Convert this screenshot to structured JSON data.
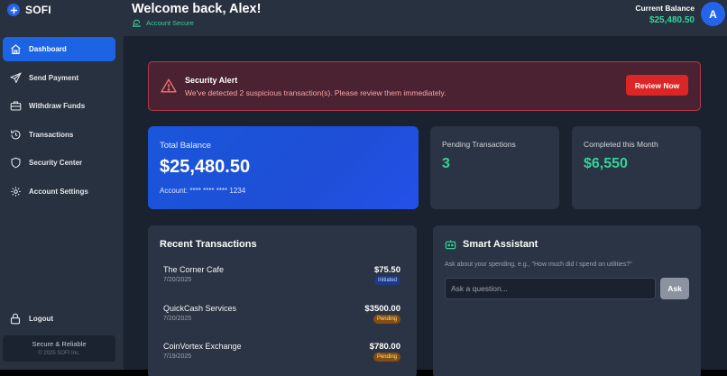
{
  "brand": {
    "name": "SOFI"
  },
  "sidebar": {
    "items": [
      {
        "label": "Dashboard",
        "icon": "home-icon",
        "active": true
      },
      {
        "label": "Send Payment",
        "icon": "send-icon",
        "active": false
      },
      {
        "label": "Withdraw Funds",
        "icon": "briefcase-icon",
        "active": false
      },
      {
        "label": "Transactions",
        "icon": "history-icon",
        "active": false
      },
      {
        "label": "Security Center",
        "icon": "shield-icon",
        "active": false
      },
      {
        "label": "Account Settings",
        "icon": "gear-icon",
        "active": false
      }
    ],
    "logout": "Logout",
    "footer_title": "Secure & Reliable",
    "footer_copy": "© 2025 SOFI Inc."
  },
  "header": {
    "welcome": "Welcome back, Alex!",
    "status": "Account Secure",
    "balance_label": "Current Balance",
    "balance_value": "$25,480.50",
    "avatar_initial": "A"
  },
  "alert": {
    "title": "Security Alert",
    "message": "We've detected 2 suspicious transaction(s). Please review them immediately.",
    "button": "Review Now"
  },
  "stats": {
    "total_label": "Total Balance",
    "total_value": "$25,480.50",
    "account": "Account: **** **** **** 1234",
    "pending_label": "Pending Transactions",
    "pending_value": "3",
    "completed_label": "Completed this Month",
    "completed_value": "$6,550"
  },
  "recent": {
    "title": "Recent Transactions",
    "transactions": [
      {
        "name": "The Corner Cafe",
        "date": "7/20/2025",
        "amount": "$75.50",
        "status": "Initiated"
      },
      {
        "name": "QuickCash Services",
        "date": "7/20/2025",
        "amount": "$3500.00",
        "status": "Pending"
      },
      {
        "name": "CoinVortex Exchange",
        "date": "7/19/2025",
        "amount": "$780.00",
        "status": "Pending"
      }
    ]
  },
  "assistant": {
    "title": "Smart Assistant",
    "hint": "Ask about your spending, e.g., \"How much did I spend on utilities?\"",
    "placeholder": "Ask a question...",
    "button": "Ask"
  },
  "colors": {
    "accent": "#1d64e4",
    "success": "#34d399",
    "danger": "#dc2626",
    "sidebar_bg": "#283140",
    "main_bg": "#1a2230"
  }
}
